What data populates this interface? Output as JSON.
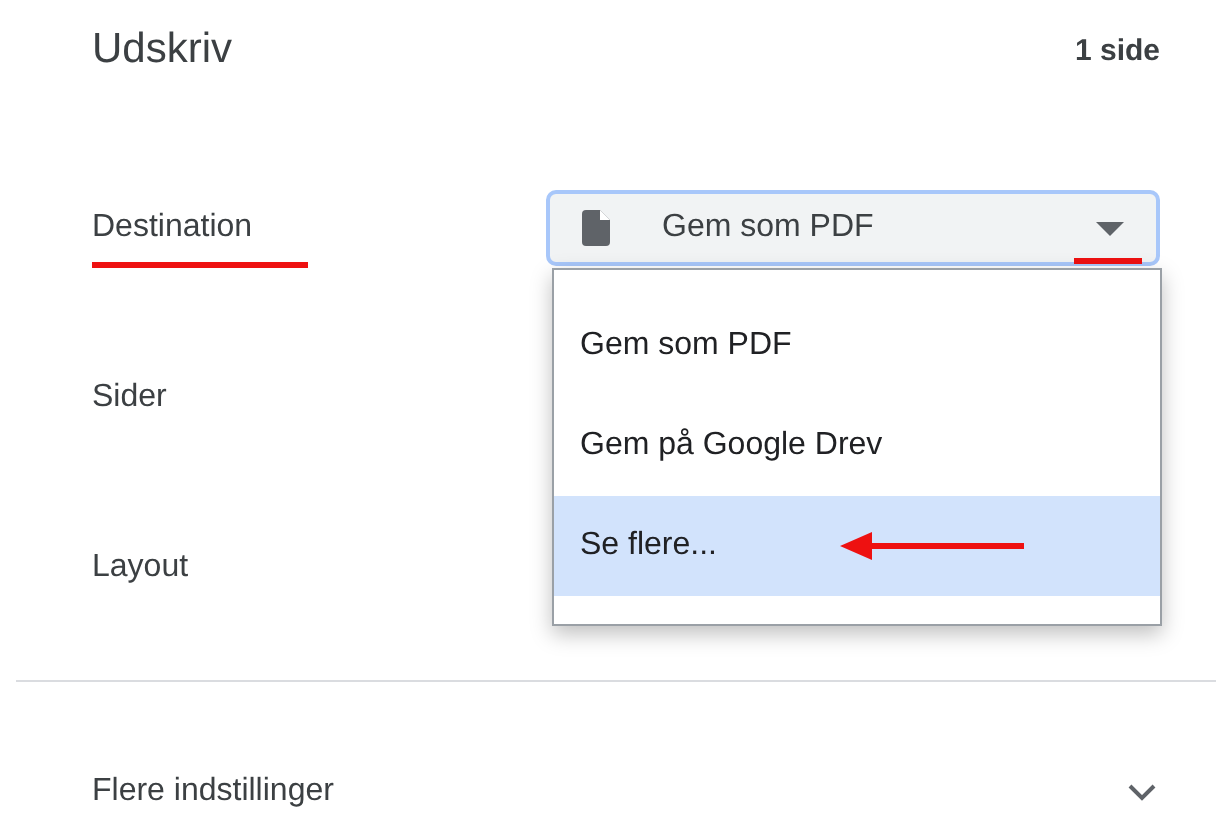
{
  "header": {
    "title": "Udskriv",
    "page_count": "1 side"
  },
  "settings": [
    {
      "kind": "select",
      "label": "Destination",
      "value": "Gem som PDF",
      "expanded": true
    },
    {
      "kind": "plain",
      "label": "Sider"
    },
    {
      "kind": "plain",
      "label": "Layout"
    }
  ],
  "menu": {
    "items": [
      {
        "label": "Gem som PDF",
        "selected": false
      },
      {
        "label": "Gem på Google Drev",
        "selected": false
      },
      {
        "label": "Se flere...",
        "selected": true
      }
    ]
  },
  "more": {
    "label": "Flere indstillinger",
    "expanded": false
  }
}
